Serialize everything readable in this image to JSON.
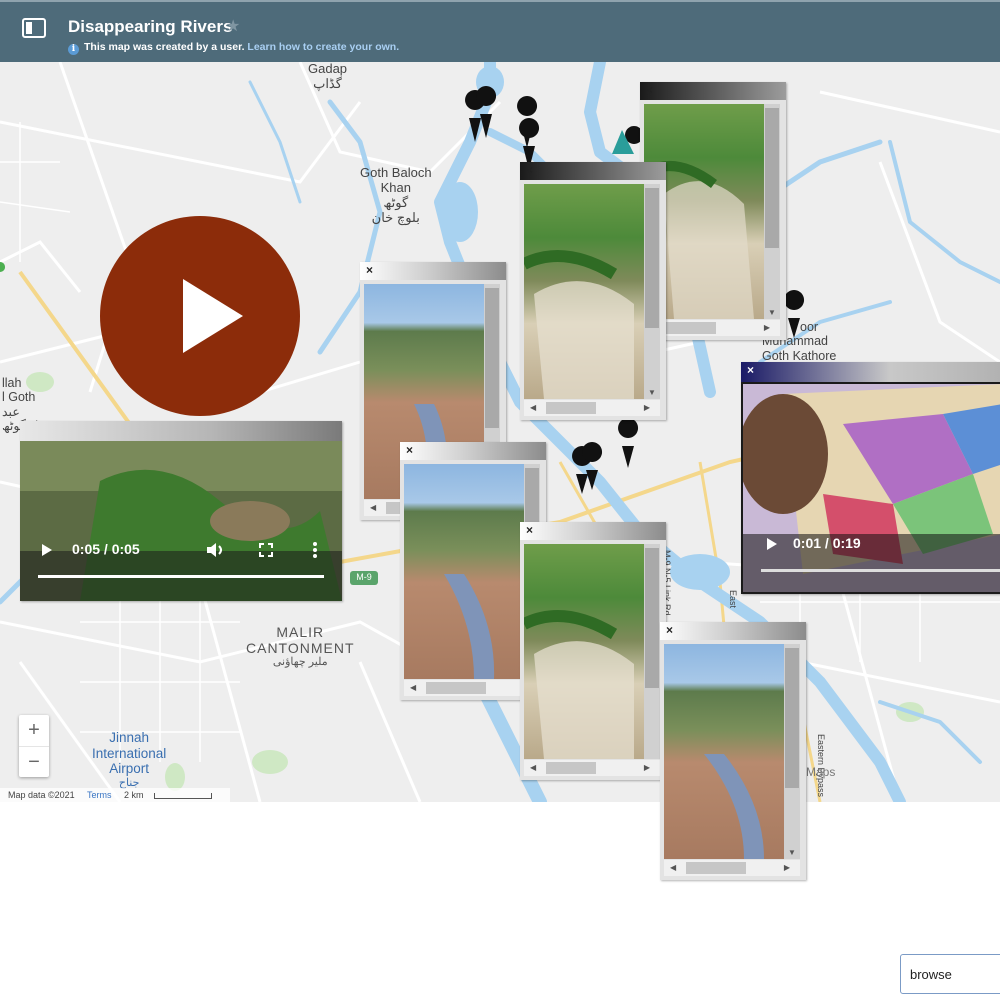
{
  "header": {
    "title": "Disappearing Rivers",
    "notice": "This map was created by a user.",
    "notice_link": "Learn how to create your own."
  },
  "map": {
    "labels": {
      "gadap": "Gadap",
      "gadap_urdu": "گڈاپ",
      "goth_baloch_1": "Goth Baloch",
      "goth_baloch_2": "Khan",
      "goth_baloch_urdu1": "گوٹھ",
      "goth_baloch_urdu2": "بلوچ خان",
      "kathore_1": "oor",
      "kathore_2": "Muhammad",
      "kathore_3": "Goth Kathore",
      "abdullah_1": "llah",
      "abdullah_2": "l Goth",
      "abdullah_3": "عبد",
      "abdullah_4": "ل گوٹھ",
      "malir_1": "MALIR",
      "malir_2": "CANTONMENT",
      "malir_urdu": "ملیر چھاؤنی",
      "jinnah_1": "Jinnah",
      "jinnah_2": "International",
      "jinnah_3": "Airport",
      "jinnah_urdu": "جناح",
      "m9": "M-9",
      "m9_link": "M-9 N-5 Link Rd",
      "east": "East",
      "eastern_bypass": "Eastern Bypass",
      "maps": "Maps"
    },
    "zoom_in": "+",
    "zoom_out": "−",
    "map_data": "Map data ©2021",
    "terms": "Terms",
    "scale": "2 km"
  },
  "windows": {
    "close": "×"
  },
  "video_left": {
    "time": "0:05 / 0:05",
    "progress": 1.0
  },
  "video_right": {
    "time": "0:01 / 0:19",
    "progress": 0.05
  },
  "browse": {
    "label": "browse"
  },
  "icons": {
    "sidebar": "sidebar-toggle-icon",
    "star": "star-icon",
    "info": "info-icon",
    "play": "play-icon",
    "volume": "volume-icon",
    "fullscreen": "fullscreen-icon",
    "more": "more-vert-icon",
    "pin": "map-pin-icon"
  },
  "colors": {
    "header": "#4e6b7a",
    "water": "#a8d2f0",
    "big_play": "#8c2c0a",
    "link": "#a9cff2"
  }
}
